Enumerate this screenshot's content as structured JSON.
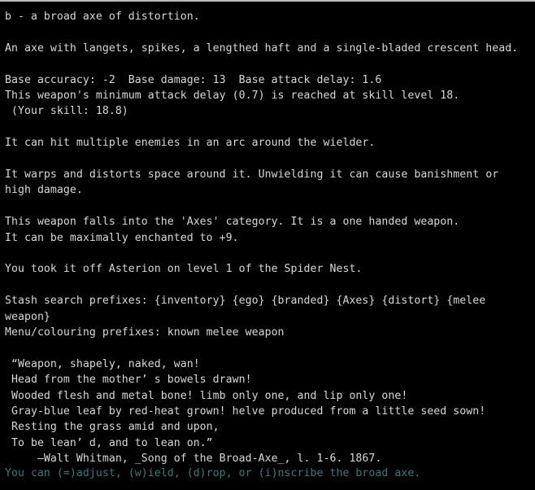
{
  "screen": {
    "kind": "dcss-item-description",
    "background_color": "#000000",
    "text_color": "#d8d8d8",
    "prompt_color": "#2e7d80",
    "top_rule_color": "#b9b9b9"
  },
  "item": {
    "header": "b - a broad axe of distortion.",
    "flavour": "An axe with langets, spikes, a lengthed haft and a single-bladed crescent head."
  },
  "stats": {
    "base_line": "Base accuracy: -2  Base damage: 13  Base attack delay: 1.6",
    "base_accuracy": "-2",
    "base_damage": "13",
    "base_attack_delay": "1.6",
    "min_delay_line": "This weapon's minimum attack delay (0.7) is reached at skill level 18.",
    "min_attack_delay": "0.7",
    "min_delay_skill_level": "18",
    "your_skill_line": " (Your skill: 18.8)",
    "your_skill": "18.8"
  },
  "properties": {
    "cleave": "It can hit multiple enemies in an arc around the wielder.",
    "brand_1": "It warps and distorts space around it. Unwielding it can cause banishment or",
    "brand_2": "high damage.",
    "category": "This weapon falls into the 'Axes' category. It is a one handed weapon.",
    "enchant_cap": "It can be maximally enchanted to +9."
  },
  "history": {
    "origin": "You took it off Asterion on level 1 of the Spider Nest."
  },
  "prefixes": {
    "stash_line_1": "Stash search prefixes: {inventory} {ego} {branded} {Axes} {distort} {melee",
    "stash_line_2": "weapon}",
    "stash_tokens": [
      "{inventory}",
      "{ego}",
      "{branded}",
      "{Axes}",
      "{distort}",
      "{melee weapon}"
    ],
    "menu_line": "Menu/colouring prefixes: known melee weapon"
  },
  "quote": {
    "lines": [
      " “Weapon, shapely, naked, wan!",
      " Head from the mother’ s bowels drawn!",
      " Wooded flesh and metal bone! limb only one, and lip only one!",
      " Gray-blue leaf by red-heat grown! helve produced from a little seed sown!",
      " Resting the grass amid and upon,",
      " To be lean’ d, and to lean on.”",
      "     —Walt Whitman, _Song of the Broad-Axe_, l. 1-6. 1867."
    ],
    "attribution_author": "Walt Whitman",
    "attribution_work": "_Song of the Broad-Axe_",
    "attribution_lines": "l. 1-6.",
    "attribution_year": "1867."
  },
  "footer": {
    "prompt": "You can (=)adjust, (w)ield, (d)rop, or (i)nscribe the broad axe.",
    "commands": [
      {
        "key": "=",
        "label": "adjust"
      },
      {
        "key": "w",
        "label": "wield"
      },
      {
        "key": "d",
        "label": "drop"
      },
      {
        "key": "i",
        "label": "inscribe"
      }
    ],
    "target": "the broad axe"
  }
}
